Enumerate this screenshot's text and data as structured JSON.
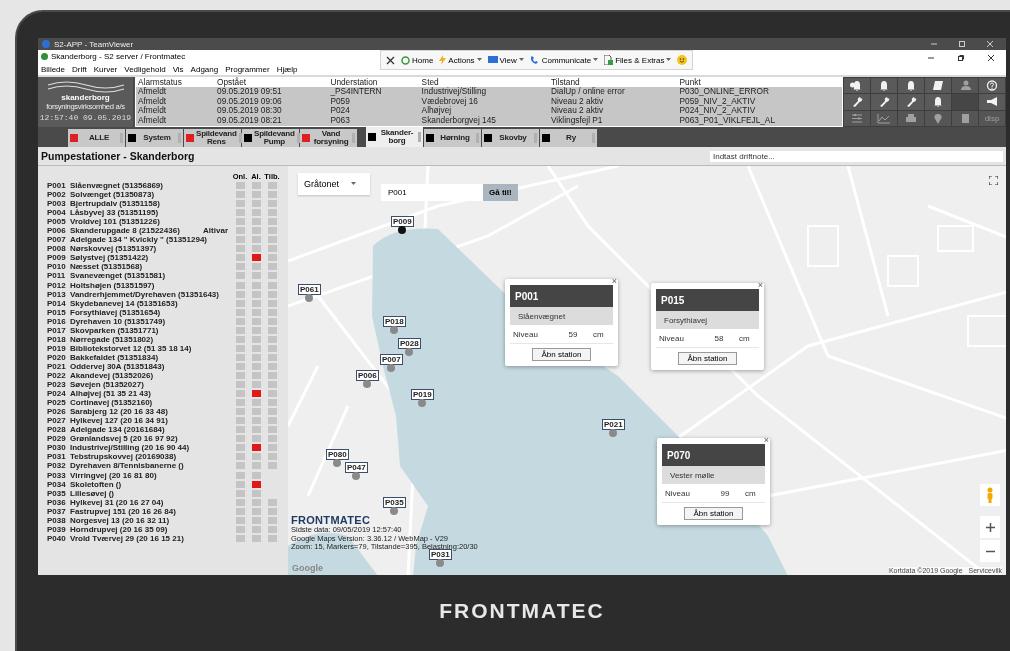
{
  "teamviewer": {
    "title": "S2-APP - TeamViewer"
  },
  "app": {
    "title": "Skanderborg - S2 server / Frontmatec",
    "menu": [
      "Billede",
      "Drift",
      "Kurver",
      "Vedligehold",
      "Vis",
      "Adgang",
      "Programmer",
      "Hjælp"
    ],
    "toolbar": [
      {
        "label": "Home",
        "dropdown": false
      },
      {
        "label": "Actions",
        "dropdown": true
      },
      {
        "label": "View",
        "dropdown": true
      },
      {
        "label": "Communicate",
        "dropdown": true
      },
      {
        "label": "Files & Extras",
        "dropdown": true
      }
    ]
  },
  "logo": {
    "name": "skanderborg",
    "subtitle": "forsyningsvirksomhed a/s",
    "clock": "12:57:40 09.05.2019"
  },
  "alarms": {
    "columns": [
      "Alarmstatus",
      "Opstået",
      "Understation",
      "Sted",
      "Tilstand",
      "Punkt"
    ],
    "rows": [
      [
        "Afmeldt",
        "09.05.2019 09:51",
        "_PS4INTERN",
        "Industrivej/Stilling",
        "DialUp / online error",
        "P030_ONLINE_ERROR"
      ],
      [
        "Afmeldt",
        "09.05.2019 09:06",
        "P059",
        "Vædebrovej 16",
        "Niveau 2 aktiv",
        "P059_NIV_2_AKTIV"
      ],
      [
        "Afmeldt",
        "09.05.2019 08:30",
        "P024",
        "Alhøjvej",
        "Niveau 2 aktiv",
        "P024_NIV_2_AKTIV"
      ],
      [
        "Afmeldt",
        "09.05.2019 08:21",
        "P063",
        "Skanderborgvej 145",
        "Viklingsfejl P1",
        "P063_P01_VIKLFEJL_AL"
      ]
    ]
  },
  "tool_buttons": [
    [
      {
        "disabled": false
      },
      {
        "disabled": false
      },
      {
        "disabled": false
      },
      {
        "disabled": false
      },
      {
        "disabled": true
      },
      {
        "disabled": false
      }
    ],
    [
      {
        "disabled": false
      },
      {
        "disabled": false
      },
      {
        "disabled": false
      },
      {
        "disabled": false
      },
      {
        "disabled": true
      },
      {
        "disabled": false
      }
    ],
    [
      {
        "disabled": true
      },
      {
        "disabled": true
      },
      {
        "disabled": true
      },
      {
        "disabled": true
      },
      {
        "disabled": true
      },
      {
        "disabled": true,
        "label": "disp"
      }
    ]
  ],
  "tabs": [
    {
      "label": "ALLE",
      "color": "#e02020",
      "selected": false
    },
    {
      "label": "System",
      "color": "#000000",
      "selected": false
    },
    {
      "label": "Spildevand Rens",
      "color": "#e02020",
      "selected": false
    },
    {
      "label": "Spildevand Pump",
      "color": "#000000",
      "selected": false
    },
    {
      "label": "Vand forsyning",
      "color": "#e02020",
      "selected": false
    },
    {
      "label": "Skander- borg",
      "color": "#000000",
      "selected": true
    },
    {
      "label": "Hørning",
      "color": "#000000",
      "selected": false
    },
    {
      "label": "Skovby",
      "color": "#000000",
      "selected": false
    },
    {
      "label": "Ry",
      "color": "#000000",
      "selected": false
    }
  ],
  "page_title": "Pumpestationer - Skanderborg",
  "driftnote": {
    "placeholder": "Indtast driftnote..."
  },
  "stations": {
    "columns": [
      "Onl.",
      "Al.",
      "Tilb."
    ],
    "rows": [
      {
        "id": "P001",
        "name": "Slåenvægnet (51356869)",
        "al": false,
        "tilb": true
      },
      {
        "id": "P002",
        "name": "Solvænget (51350873)",
        "al": false,
        "tilb": true
      },
      {
        "id": "P003",
        "name": "Bjertrupdalv (51351158)",
        "al": false,
        "tilb": true
      },
      {
        "id": "P004",
        "name": "Låsbyvej 33 (51351195)",
        "al": false,
        "tilb": true
      },
      {
        "id": "P005",
        "name": "Vroldvej 101 (51351226)",
        "al": false,
        "tilb": true
      },
      {
        "id": "P006",
        "name": "Skanderupgade 8 (21522436)",
        "note": "Altivar",
        "al": false,
        "tilb": true
      },
      {
        "id": "P007",
        "name": "Adelgade 134 \" Kvickly \" (51351294)",
        "al": false,
        "tilb": true
      },
      {
        "id": "P008",
        "name": "Nørskovvej (51351397)",
        "al": false,
        "tilb": true
      },
      {
        "id": "P009",
        "name": "Sølystvej (51351422)",
        "al": true,
        "tilb": true
      },
      {
        "id": "P010",
        "name": "Næsset (51351568)",
        "al": false,
        "tilb": true
      },
      {
        "id": "P011",
        "name": "Svanevænget (51351581)",
        "al": false,
        "tilb": true
      },
      {
        "id": "P012",
        "name": "Holtshøjen (51351597)",
        "al": false,
        "tilb": true
      },
      {
        "id": "P013",
        "name": "Vandrerhjemmet/Dyrehaven (51351643)",
        "al": false,
        "tilb": true
      },
      {
        "id": "P014",
        "name": "Skydebanevej 14 (51351653)",
        "al": false,
        "tilb": true
      },
      {
        "id": "P015",
        "name": "Forsythiavej (51351654)",
        "al": false,
        "tilb": true
      },
      {
        "id": "P016",
        "name": "Dyrehaven 10 (51351749)",
        "al": false,
        "tilb": true
      },
      {
        "id": "P017",
        "name": "Skovparken (51351771)",
        "al": false,
        "tilb": true
      },
      {
        "id": "P018",
        "name": "Nørregade (51351802)",
        "al": false,
        "tilb": true
      },
      {
        "id": "P019",
        "name": "Bibliotekstorvet 12 (51 35 18 14)",
        "al": false,
        "tilb": true
      },
      {
        "id": "P020",
        "name": "Bakkefaldet (51351834)",
        "al": false,
        "tilb": true
      },
      {
        "id": "P021",
        "name": "Oddervej 30A (51351843)",
        "al": false,
        "tilb": true
      },
      {
        "id": "P022",
        "name": "Akandevej (51352026)",
        "al": false,
        "tilb": true
      },
      {
        "id": "P023",
        "name": "Søvejen (51352027)",
        "al": false,
        "tilb": true
      },
      {
        "id": "P024",
        "name": "Alhøjvej (51 35 21 43)",
        "al": true,
        "tilb": true
      },
      {
        "id": "P025",
        "name": "Cortinavej (51352160)",
        "al": false,
        "tilb": true
      },
      {
        "id": "P026",
        "name": "Sarabjerg 12 (20 16 33 48)",
        "al": false,
        "tilb": true
      },
      {
        "id": "P027",
        "name": "Hylkevej 127 (20 16 34 91)",
        "al": false,
        "tilb": true
      },
      {
        "id": "P028",
        "name": "Adelgade 134 (20161684)",
        "al": false,
        "tilb": true
      },
      {
        "id": "P029",
        "name": "Grønlandsvej 5 (20 16 97 92)",
        "al": false,
        "tilb": true
      },
      {
        "id": "P030",
        "name": "Industrivej/Stilling (20 16 90 44)",
        "al": true,
        "tilb": true
      },
      {
        "id": "P031",
        "name": "Tebstrupskovvej (20169038)",
        "al": false,
        "tilb": true
      },
      {
        "id": "P032",
        "name": "Dyrehaven 8/Tennisbanerne ()",
        "al": false,
        "tilb": true
      },
      {
        "id": "P033",
        "name": "Virringvej (20 16 81 80)",
        "al": false,
        "tilb": false
      },
      {
        "id": "P034",
        "name": "Skoletoften ()",
        "al": true,
        "tilb": false
      },
      {
        "id": "P035",
        "name": "Lillesøvej ()",
        "al": false,
        "tilb": false
      },
      {
        "id": "P036",
        "name": "Hylkevej 31 (20 16 27 04)",
        "al": false,
        "tilb": true
      },
      {
        "id": "P037",
        "name": "Fastrupvej 151 (20 16 26 84)",
        "al": false,
        "tilb": true
      },
      {
        "id": "P038",
        "name": "Norgesvej 13 (20 16 32 11)",
        "al": false,
        "tilb": true
      },
      {
        "id": "P039",
        "name": "Horndrupvej (20 16 35 09)",
        "al": false,
        "tilb": true
      },
      {
        "id": "P040",
        "name": "Vrold  Tværvej 29 (20 16 15 21)",
        "al": false,
        "tilb": true
      }
    ]
  },
  "map": {
    "style_select": "Gråtonet",
    "search": {
      "value": "P001",
      "button": "Gå til!"
    },
    "markers": [
      {
        "label": "P009",
        "color": "#111111"
      },
      {
        "label": "P061",
        "color": "#8a8a8a"
      },
      {
        "label": "P018",
        "color": "#8a8a8a"
      },
      {
        "label": "P028",
        "color": "#8a8a8a"
      },
      {
        "label": "P007",
        "color": "#8a8a8a"
      },
      {
        "label": "P006",
        "color": "#8a8a8a"
      },
      {
        "label": "P019",
        "color": "#8a8a8a"
      },
      {
        "label": "P021",
        "color": "#8a8a8a"
      },
      {
        "label": "P080",
        "color": "#8a8a8a"
      },
      {
        "label": "P047",
        "color": "#8a8a8a"
      },
      {
        "label": "P035",
        "color": "#8a8a8a"
      },
      {
        "label": "P031",
        "color": "#8a8a8a"
      }
    ],
    "popups": [
      {
        "close": "×",
        "title": "P001",
        "subtitle": "Slåenvægnet",
        "level_label": "Niveau",
        "value": "59",
        "unit": "cm",
        "button": "Åbn station"
      },
      {
        "close": "×",
        "title": "P015",
        "subtitle": "Forsythiavej",
        "level_label": "Niveau",
        "value": "58",
        "unit": "cm",
        "button": "Åbn station"
      },
      {
        "close": "×",
        "title": "P070",
        "subtitle": "Vester mølle",
        "level_label": "Niveau",
        "value": "99",
        "unit": "cm",
        "button": "Åbn station"
      }
    ],
    "info": {
      "brand": "FRONTMATEC",
      "lines": [
        "Sidste data: 09/05/2019 12:57:40",
        "Google Maps Version: 3.36.12 / WebMap - V29",
        "Zoom: 15, Markers=79, Tilstande=395, Belastning:20/30"
      ]
    },
    "google": "Google",
    "attribution": [
      "Kortdata ©2019 Google",
      "Servicevilk"
    ]
  },
  "device_brand": "FRONTMATEC"
}
